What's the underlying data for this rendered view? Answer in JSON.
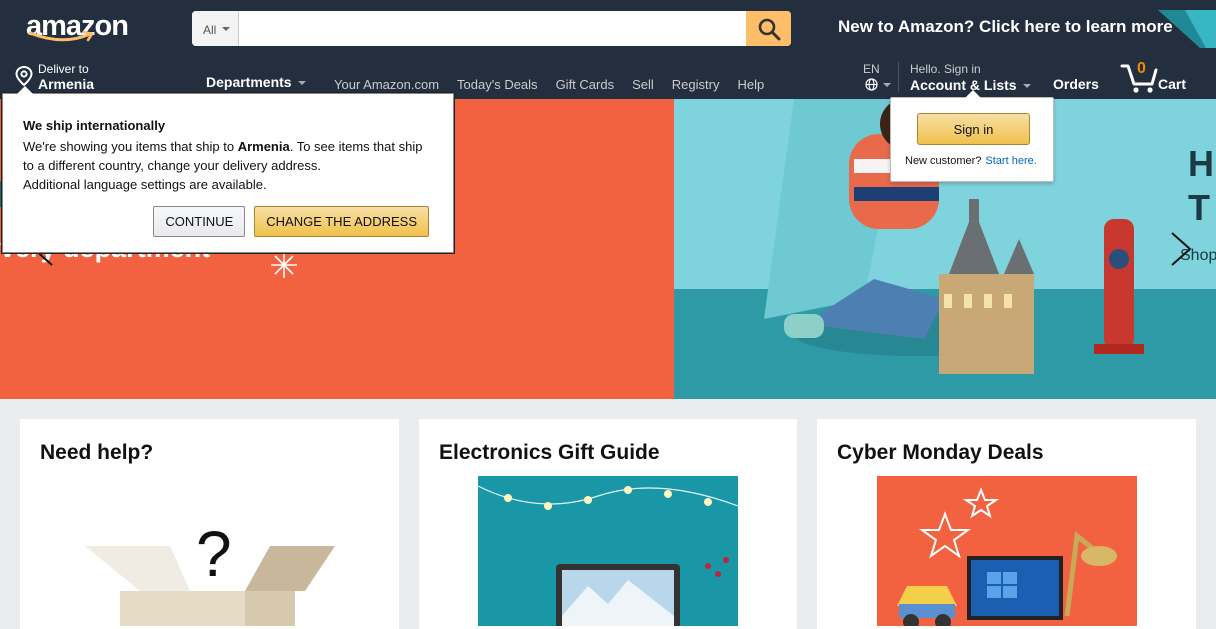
{
  "header": {
    "logo_text": "amazon",
    "search": {
      "category": "All",
      "value": "",
      "placeholder": ""
    },
    "promo_text": "New to Amazon? Click here to learn more",
    "deliver": {
      "line1": "Deliver to",
      "line2": "Armenia"
    },
    "departments_label": "Departments",
    "nav_links": [
      "Your Amazon.com",
      "Today's Deals",
      "Gift Cards",
      "Sell",
      "Registry",
      "Help"
    ],
    "language": "EN",
    "account": {
      "line1": "Hello. Sign in",
      "line2": "Account & Lists"
    },
    "orders_label": "Orders",
    "cart": {
      "count": "0",
      "label": "Cart"
    }
  },
  "hero": {
    "left_text": "very department",
    "right_line1": "H",
    "right_line2": "T",
    "right_line3": "Shop"
  },
  "ship_popover": {
    "title": "We ship internationally",
    "text_prefix": "We're showing you items that ship to ",
    "country": "Armenia",
    "text_suffix": ". To see items that ship to a different country, change your delivery address.",
    "text_line2": "Additional language settings are available.",
    "continue_label": "CONTINUE",
    "change_label": "CHANGE THE ADDRESS"
  },
  "signin_popover": {
    "button_label": "Sign in",
    "new_customer": "New customer?",
    "start_here": "Start here."
  },
  "cards": [
    {
      "title": "Need help?"
    },
    {
      "title": "Electronics Gift Guide"
    },
    {
      "title": "Cyber Monday Deals"
    }
  ],
  "colors": {
    "header_bg": "#232f3e",
    "search_button": "#febd69",
    "hero_left": "#f26241",
    "hero_right": "#5fc1cc",
    "cart_count": "#f08804",
    "link": "#0066c0",
    "page_bg": "#eaeded"
  }
}
